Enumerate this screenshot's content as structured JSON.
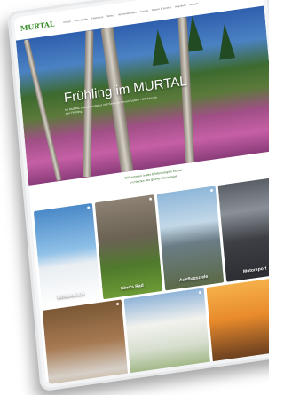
{
  "nav": {
    "logo": "MURTAL",
    "menu": [
      "Urlaub",
      "Unterkünfte",
      "Erlebnisse",
      "Winter",
      "Veranstaltungen",
      "Events",
      "Region & Service",
      "Angebote",
      "Kontakt"
    ]
  },
  "hero": {
    "title": "Frühling im MURTAL",
    "subtitle": "Im MURTAL erwachen Natur und Seele zu neuem Leben – Erleben Sie den Frühling"
  },
  "intro": {
    "line1": "Willkommen in der Erlebnisregion Murtal",
    "line2": "im Herzen der grünen Steiermark"
  },
  "tiles": [
    {
      "label": "Winterurlaub"
    },
    {
      "label": "Nina's Rad"
    },
    {
      "label": "Ausflugsziele"
    },
    {
      "label": "Motorsport"
    }
  ],
  "tiles_bottom": [
    {
      "label": ""
    },
    {
      "label": ""
    },
    {
      "label": ""
    }
  ]
}
